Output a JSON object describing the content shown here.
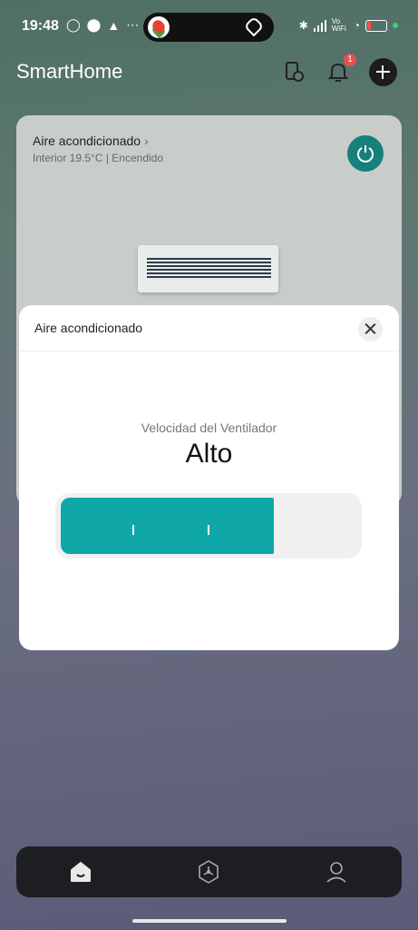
{
  "status_bar": {
    "time": "19:48",
    "left_icons": [
      "whatsapp-icon",
      "location-icon",
      "navigation-icon",
      "more-icon"
    ],
    "network_label": "Vo WiFi",
    "battery_level": 0.15
  },
  "header": {
    "title": "SmartHome",
    "notification_count": "1"
  },
  "device_card": {
    "name": "Aire acondicionado",
    "status": "Interior 19.5°C  |  Encendido"
  },
  "modal": {
    "title": "Aire acondicionado",
    "fan_label": "Velocidad del Ventilador",
    "fan_value": "Alto",
    "fan_level": 0.72,
    "accent_color": "#0fa7a7"
  },
  "nav": {
    "items": [
      "home-icon",
      "scene-icon",
      "profile-icon"
    ]
  }
}
